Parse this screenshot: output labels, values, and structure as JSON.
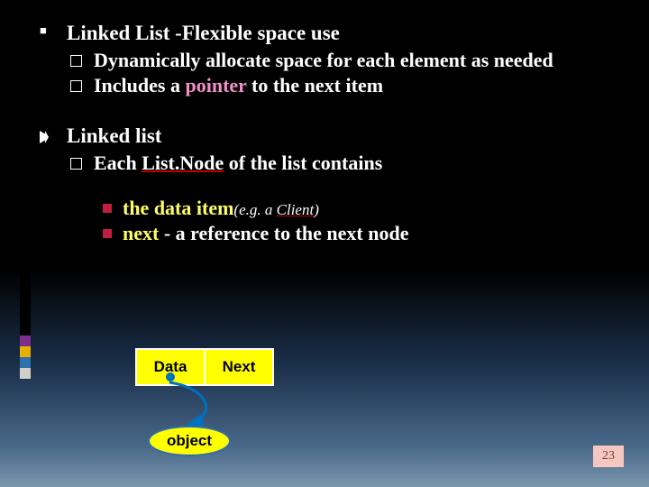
{
  "bullets": {
    "b1": {
      "title_prefix": "Linked List",
      "title_suffix": " -Flexible space use",
      "sub1": "Dynamically allocate space for each element as needed",
      "sub2_a": "Includes  a ",
      "sub2_b": "pointer",
      "sub2_c": " to the next item"
    },
    "b2": {
      "title": "Linked list",
      "sub1_a": "Each ",
      "sub1_b": "List.Node",
      "sub1_c": " of the list contains",
      "d1_a": "the data item",
      "d1_paren_open": "(",
      "d1_eg": "e.g. a ",
      "d1_client": "Client",
      "d1_paren_close": ")",
      "d2_a": "next",
      "d2_b": "  -  a reference to the next node"
    }
  },
  "diagram": {
    "data_label": "Data",
    "next_label": "Next",
    "object_label": "object"
  },
  "page_number": "23"
}
